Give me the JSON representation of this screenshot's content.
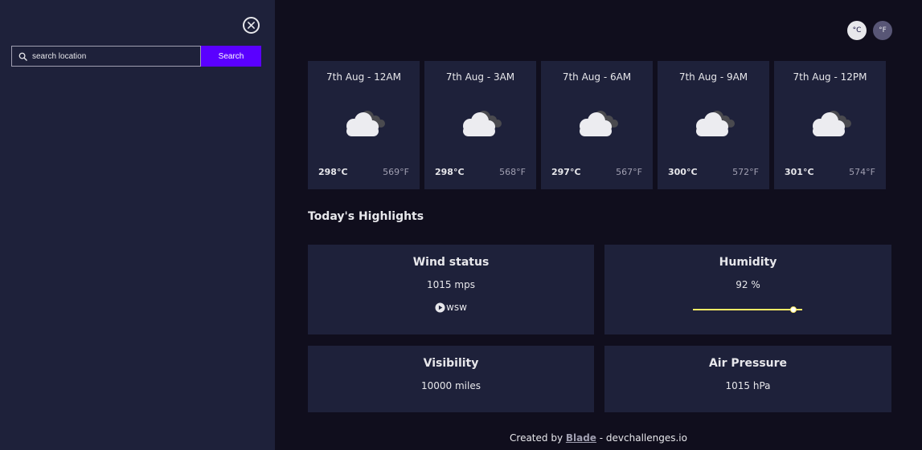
{
  "sidebar": {
    "search": {
      "placeholder": "search location",
      "value": ""
    },
    "search_button_label": "Search"
  },
  "units": {
    "celsius": "°C",
    "fahrenheit": "°F"
  },
  "forecast": [
    {
      "date": "7th Aug - 12AM",
      "max": "298°C",
      "min": "569°F",
      "icon": "cloud-icon"
    },
    {
      "date": "7th Aug - 3AM",
      "max": "298°C",
      "min": "568°F",
      "icon": "cloud-icon"
    },
    {
      "date": "7th Aug - 6AM",
      "max": "297°C",
      "min": "567°F",
      "icon": "cloud-icon"
    },
    {
      "date": "7th Aug - 9AM",
      "max": "300°C",
      "min": "572°F",
      "icon": "cloud-icon"
    },
    {
      "date": "7th Aug - 12PM",
      "max": "301°C",
      "min": "574°F",
      "icon": "cloud-icon"
    }
  ],
  "highlights": {
    "title": "Today's Highlights",
    "wind": {
      "label": "Wind status",
      "value": "1015 mps",
      "direction": "wsw"
    },
    "humidity": {
      "label": "Humidity",
      "value": "92 %",
      "percent": 92
    },
    "visibility": {
      "label": "Visibility",
      "value": "10000 miles"
    },
    "pressure": {
      "label": "Air Pressure",
      "value": "1015 hPa"
    }
  },
  "footer": {
    "prefix": "Created by ",
    "author": "Blade",
    "suffix": " - devchallenges.io"
  },
  "colors": {
    "sidebar_bg": "#1e213a",
    "main_bg": "#100e1d",
    "accent": "#5a00ff",
    "humidity_bar": "#ffec65"
  }
}
